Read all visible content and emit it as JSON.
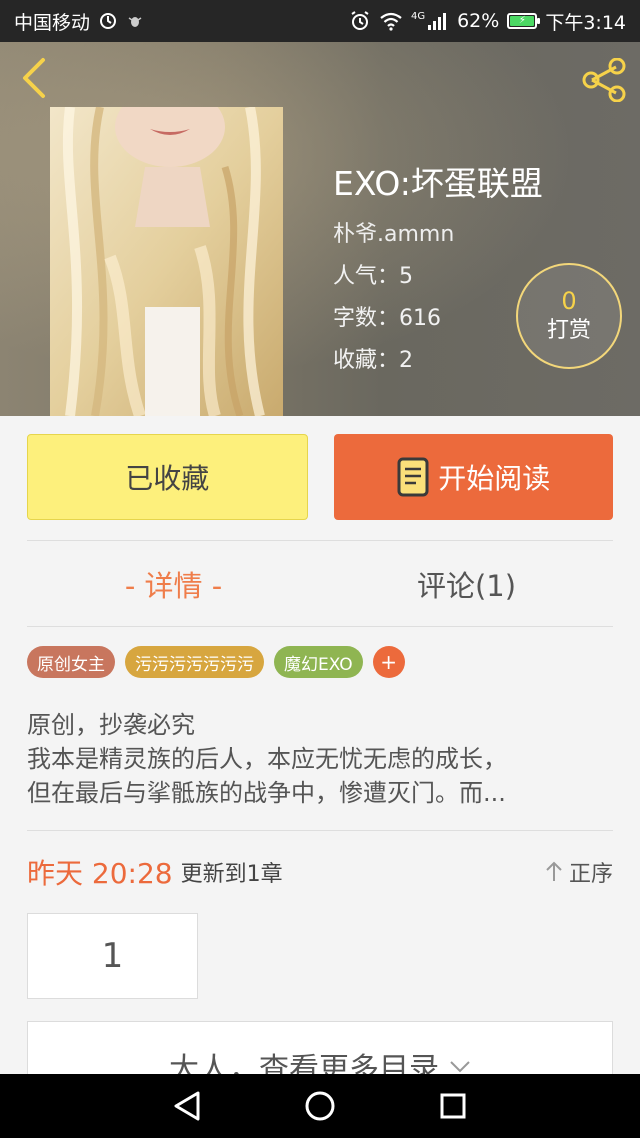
{
  "status_bar": {
    "carrier": "中国移动",
    "network": "4G",
    "battery_percent": "62%",
    "time": "下午3:14"
  },
  "header": {
    "book_title": "EXO:坏蛋联盟",
    "author": "朴爷.ammn",
    "popularity": "人气：5",
    "word_count": "字数：616",
    "favorites": "收藏：2",
    "tip_count": "0",
    "tip_label": "打赏"
  },
  "actions": {
    "favorited_label": "已收藏",
    "start_reading_label": "开始阅读"
  },
  "tabs": [
    {
      "label": "- 详情 -"
    },
    {
      "label": "评论(1)"
    }
  ],
  "tags": [
    {
      "label": "原创女主",
      "color": "#c8765e"
    },
    {
      "label": "污污污污污污污",
      "color": "#d7a63f"
    },
    {
      "label": "魔幻EXO",
      "color": "#8fb552"
    }
  ],
  "tag_add": "+",
  "description": {
    "lines": [
      "原创，抄袭必究",
      "我本是精灵族的后人，本应无忧无虑的成长，",
      "但在最后与挲骶族的战争中，惨遭灭门。而..."
    ]
  },
  "update": {
    "time": "昨天 20:28",
    "text": "更新到1章",
    "sort_label": "正序"
  },
  "chapters": [
    "1"
  ],
  "more_catalog": {
    "label": "大人，查看更多目录"
  },
  "colors": {
    "accent_orange": "#ec6a3c",
    "fav_yellow": "#fdf07c",
    "tip_gold": "#f6d24a"
  }
}
